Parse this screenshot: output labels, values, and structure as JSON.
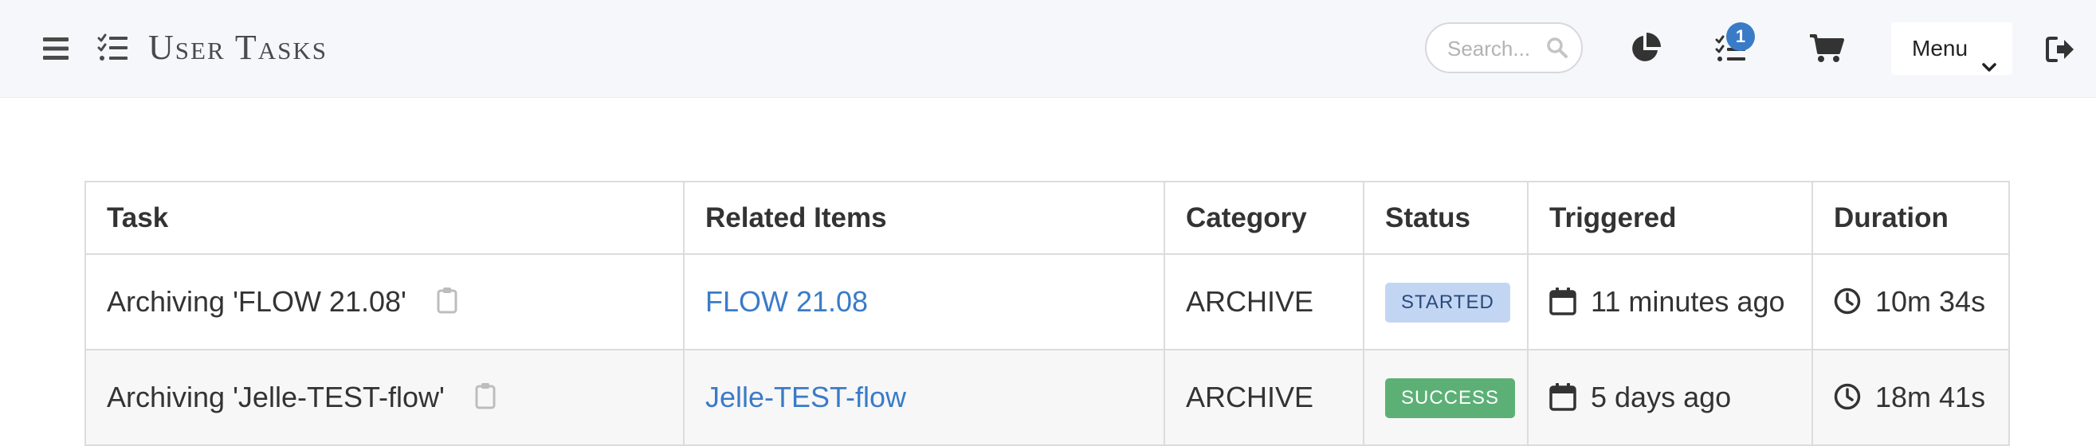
{
  "header": {
    "title": "User Tasks",
    "search_placeholder": "Search...",
    "task_badge_count": "1",
    "menu_label": "Menu",
    "icons": [
      "hamburger-icon",
      "tasks-list-icon",
      "search-icon",
      "pie-chart-icon",
      "task-checklist-icon",
      "cart-icon",
      "chevron-down-icon",
      "sign-out-icon"
    ]
  },
  "table": {
    "columns": [
      "Task",
      "Related Items",
      "Category",
      "Status",
      "Triggered",
      "Duration"
    ],
    "rows": [
      {
        "task": "Archiving 'FLOW 21.08'",
        "related": "FLOW 21.08",
        "category": "ARCHIVE",
        "status": "STARTED",
        "triggered": "11 minutes ago",
        "duration": "10m 34s"
      },
      {
        "task": "Archiving 'Jelle-TEST-flow'",
        "related": "Jelle-TEST-flow",
        "category": "ARCHIVE",
        "status": "SUCCESS",
        "triggered": "5 days ago",
        "duration": "18m 41s"
      }
    ]
  },
  "colors": {
    "link": "#3a7bc8",
    "status_started": "#c2d6f4",
    "status_success": "#5cb075",
    "badge": "#3a7bc8",
    "navbar_bg": "#f6f7fa"
  }
}
